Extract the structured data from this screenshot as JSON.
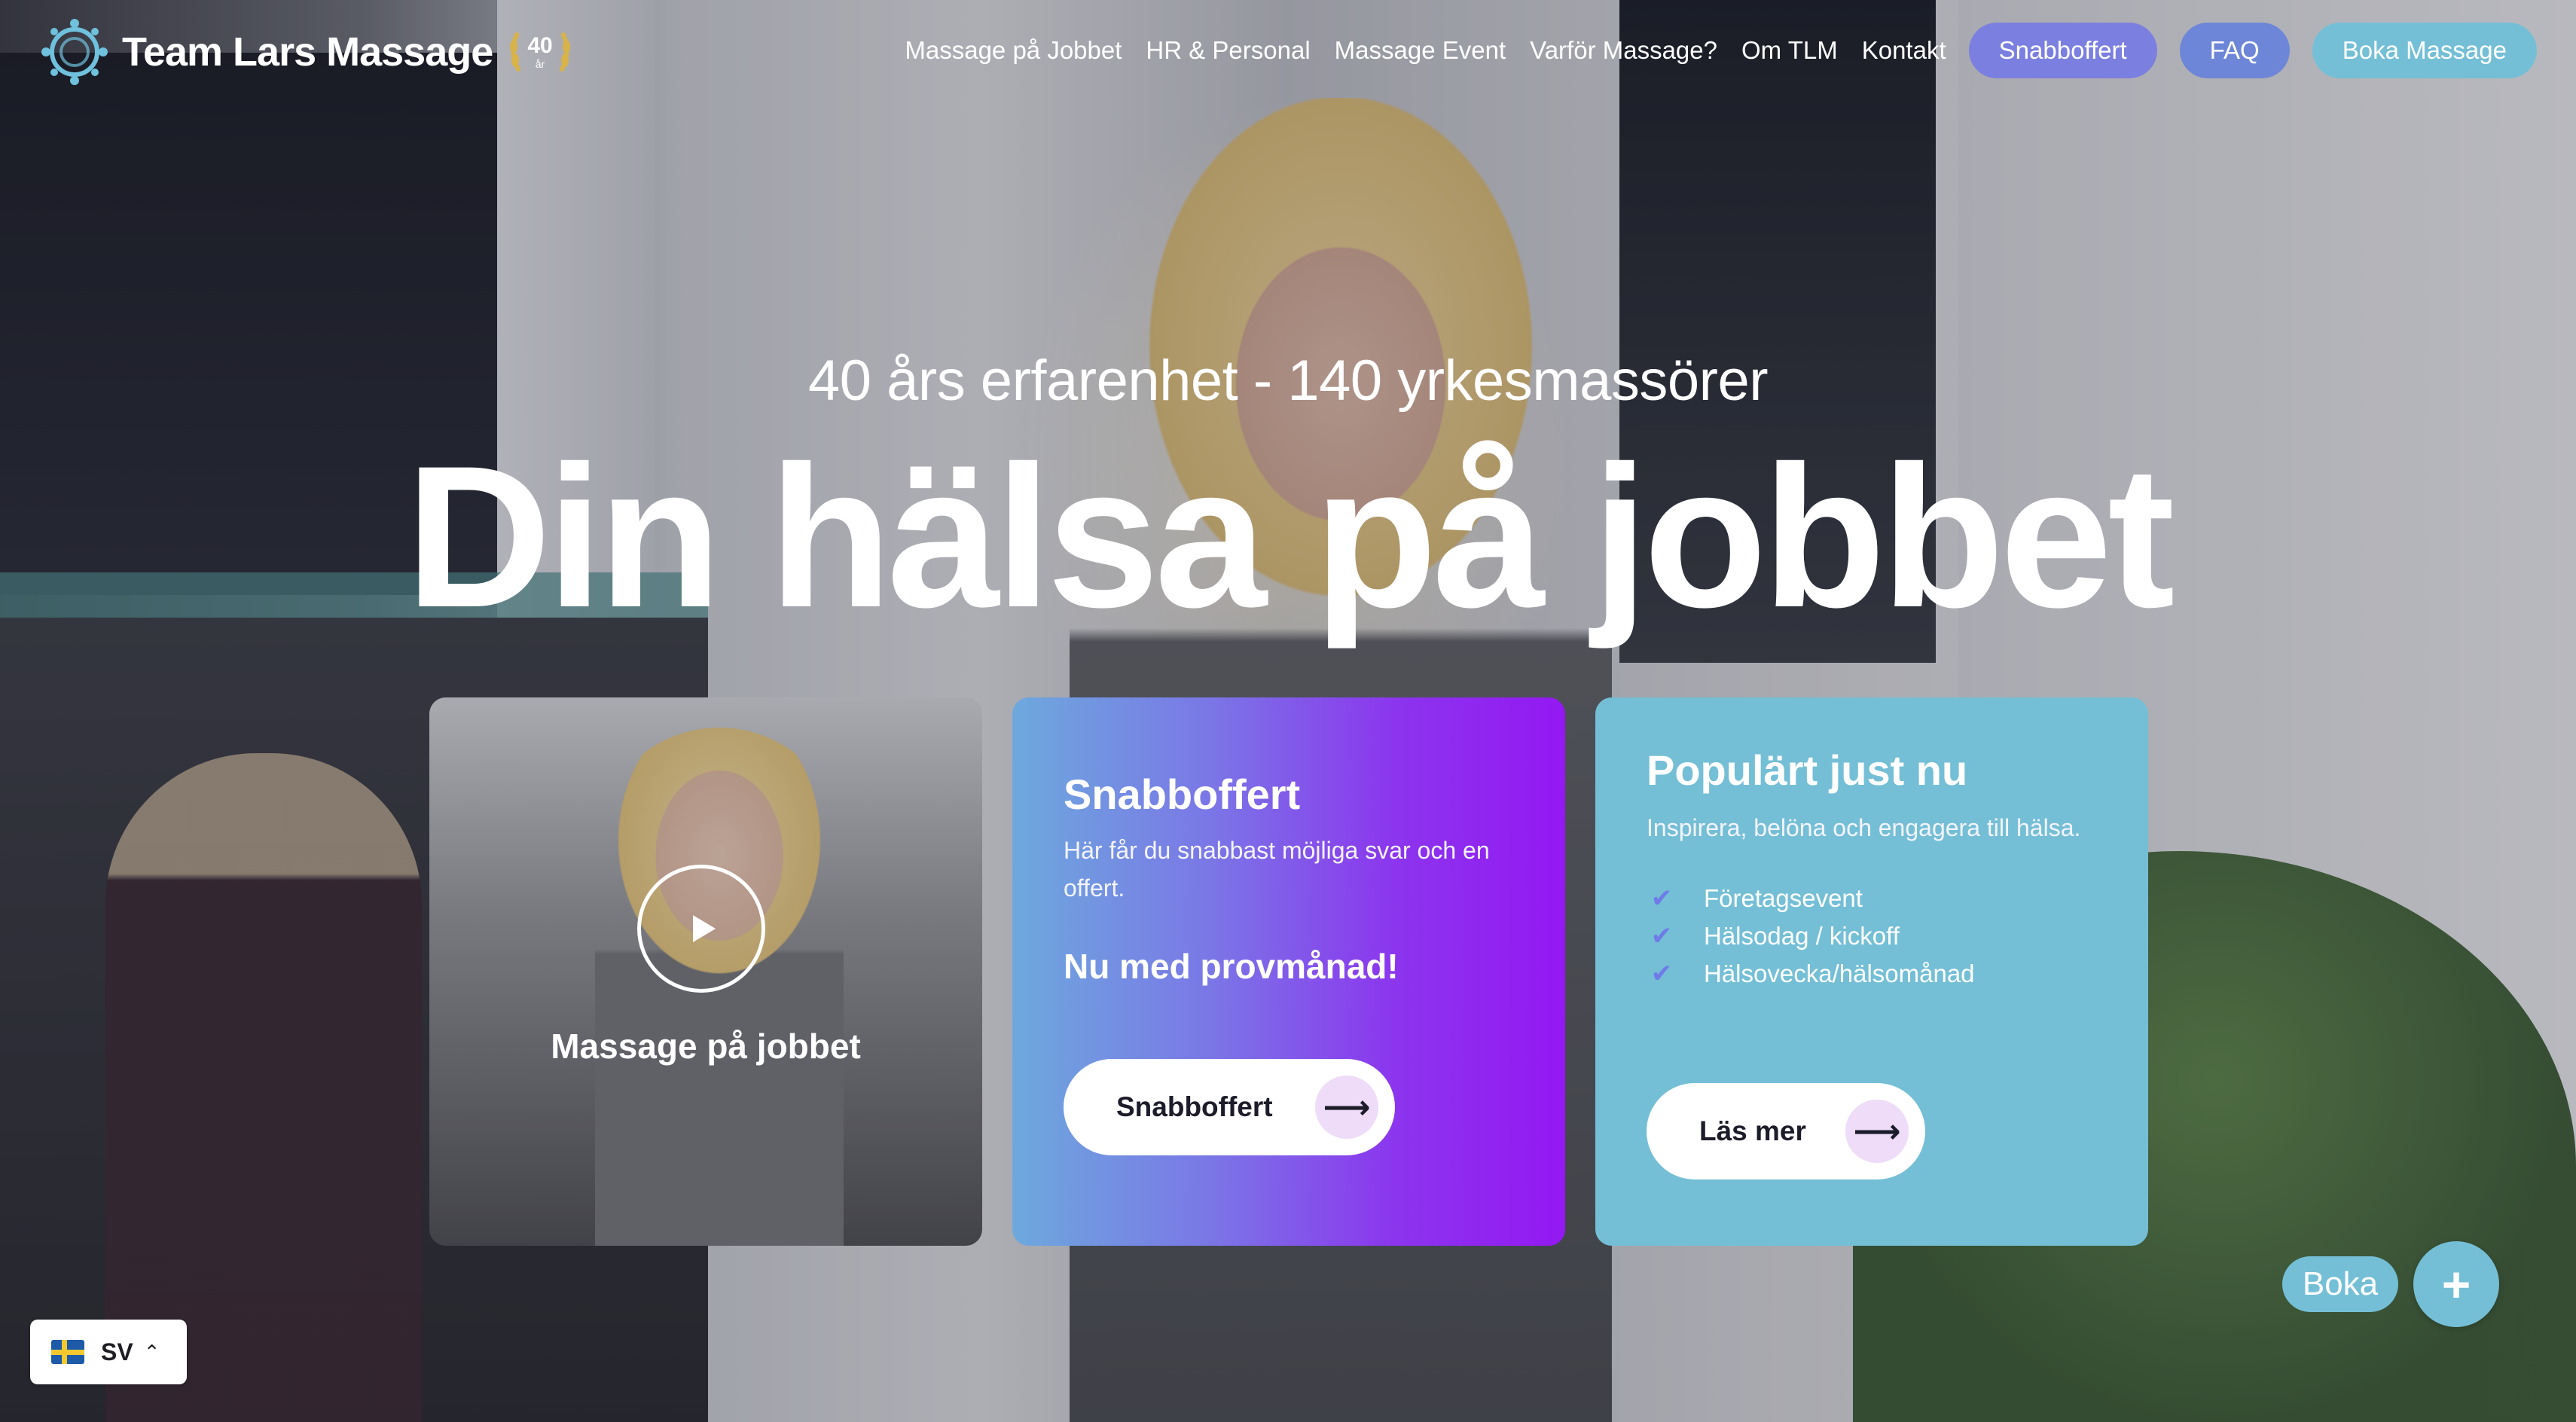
{
  "brand": {
    "name": "Team Lars Massage",
    "badge": "40",
    "badge_sub": "år"
  },
  "nav": {
    "links": [
      "Massage på Jobbet",
      "HR & Personal",
      "Massage Event",
      "Varför Massage?",
      "Om TLM",
      "Kontakt"
    ],
    "snabboffert": "Snabboffert",
    "faq": "FAQ",
    "boka": "Boka Massage"
  },
  "hero": {
    "subtitle": "40 års erfarenhet - 140 yrkesmassörer",
    "title": "Din hälsa på jobbet"
  },
  "cards": {
    "video": {
      "label": "Massage på jobbet"
    },
    "offer": {
      "heading": "Snabboffert",
      "text": "Här får du snabbast möjliga svar och en offert.",
      "highlight": "Nu med provmånad!",
      "button": "Snabboffert"
    },
    "popular": {
      "heading": "Populärt just nu",
      "text": "Inspirera, belöna och engagera till hälsa.",
      "items": [
        "Företagsevent",
        "Hälsodag / kickoff",
        "Hälsovecka/hälsomånad"
      ],
      "button": "Läs mer"
    }
  },
  "language": {
    "code": "SV"
  },
  "floating": {
    "boka": "Boka"
  },
  "colors": {
    "purple_pill": "#7b7fe0",
    "blue_pill": "#6e86d8",
    "teal": "#74bfd6",
    "offer_gradient_start": "#6da9dd",
    "offer_gradient_end": "#9418f2"
  }
}
